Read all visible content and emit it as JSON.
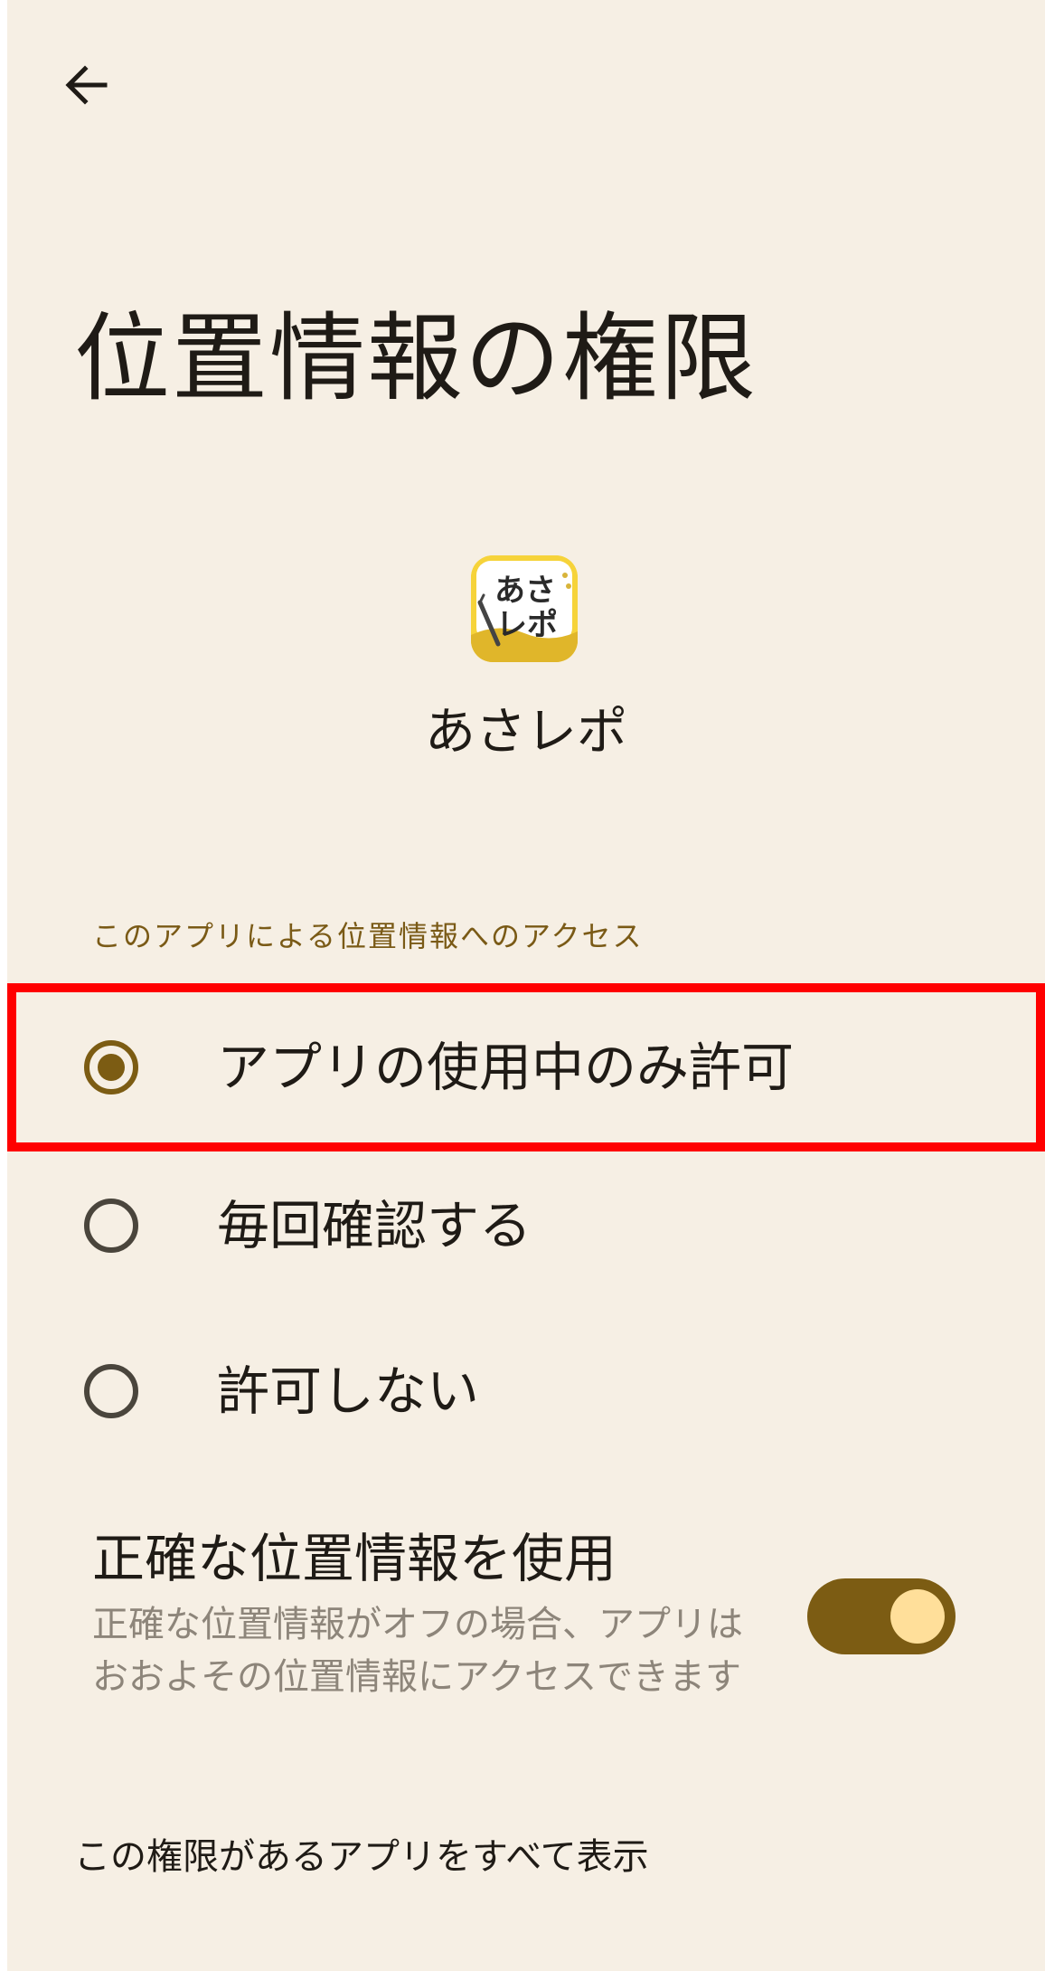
{
  "header": {
    "back_icon": "arrow-left-icon"
  },
  "page": {
    "title": "位置情報の権限"
  },
  "app": {
    "icon_text_line1": "あさ",
    "icon_text_line2": "レポ",
    "name": "あさレポ",
    "icon_color": "#f6d33a"
  },
  "section": {
    "label": "このアプリによる位置情報へのアクセス"
  },
  "options": [
    {
      "label": "アプリの使用中のみ許可",
      "selected": true
    },
    {
      "label": "毎回確認する",
      "selected": false
    },
    {
      "label": "許可しない",
      "selected": false
    }
  ],
  "precise": {
    "title": "正確な位置情報を使用",
    "description_line1": "正確な位置情報がオフの場合、アプリは",
    "description_line2": "おおよその位置情報にアクセスできます",
    "enabled": true
  },
  "footer": {
    "all_apps_link": "この権限があるアプリをすべて表示"
  },
  "colors": {
    "background": "#f6efe4",
    "accent": "#7c5c13",
    "highlight": "#ff0000",
    "toggle_thumb": "#ffdf9a"
  }
}
